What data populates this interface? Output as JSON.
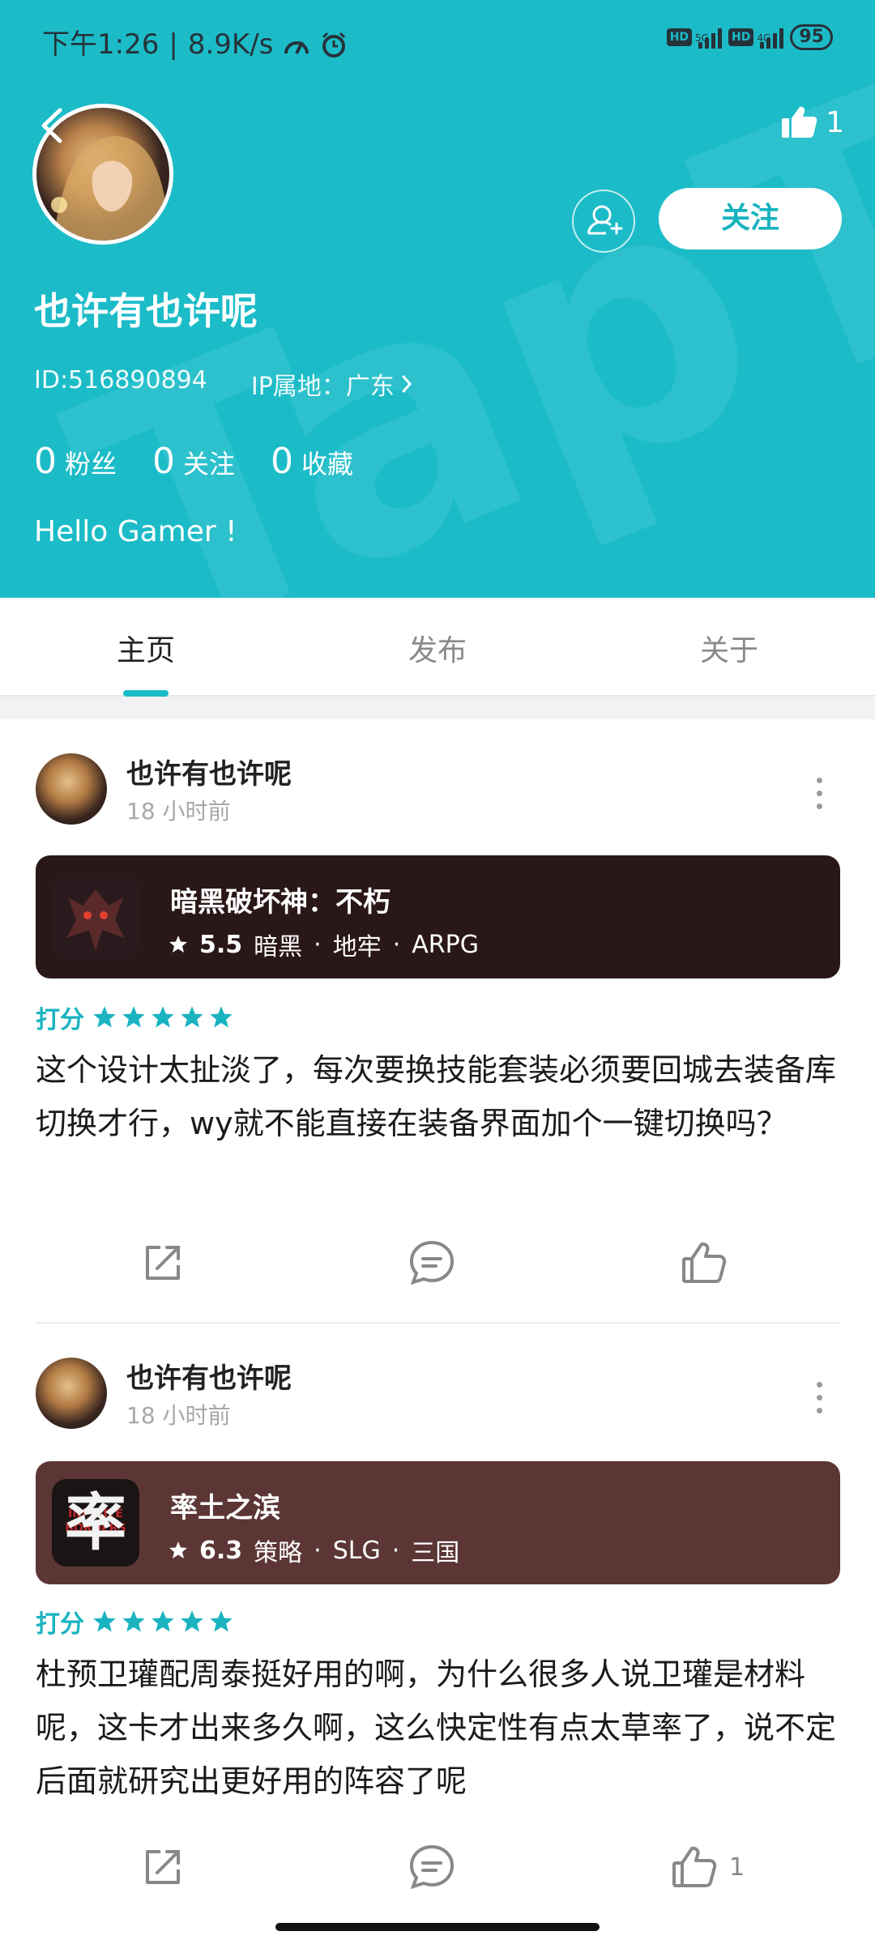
{
  "status_bar": {
    "time": "下午1:26",
    "speed": "8.9K/s",
    "network1": "5G",
    "network2": "4G",
    "hd": "HD",
    "battery": "95"
  },
  "profile": {
    "like_count": "1",
    "follow_label": "关注",
    "username": "也许有也许呢",
    "id_text": "ID:516890894",
    "ip_text": "IP属地：广东",
    "stats": [
      {
        "num": "0",
        "label": "粉丝"
      },
      {
        "num": "0",
        "label": "关注"
      },
      {
        "num": "0",
        "label": "收藏"
      }
    ],
    "bio": "Hello Gamer !",
    "watermark": "TapTap"
  },
  "tabs": [
    {
      "label": "主页",
      "active": true
    },
    {
      "label": "发布",
      "active": false
    },
    {
      "label": "关于",
      "active": false
    }
  ],
  "posts": [
    {
      "author": "也许有也许呢",
      "time": "18 小时前",
      "game": {
        "name": "暗黑破坏神：不朽",
        "score": "5.5",
        "tags": [
          "暗黑",
          "地牢",
          "ARPG"
        ],
        "card_color": "#2a1718",
        "icon_name": "diablo-demon-icon"
      },
      "rating_label": "打分",
      "rating_stars": 5,
      "content": "这个设计太扯淡了，每次要换技能套装必须要回城去装备库切换才行，wy就不能直接在装备界面加个一键切换吗？",
      "like_count": ""
    },
    {
      "author": "也许有也许呢",
      "time": "18 小时前",
      "game": {
        "name": "率土之滨",
        "score": "6.3",
        "tags": [
          "策略",
          "SLG",
          "三国"
        ],
        "card_color": "#5b3635",
        "icon_name": "shuai-character-icon",
        "icon_char": "率",
        "icon_overlay": "INFINITE BORDERS"
      },
      "rating_label": "打分",
      "rating_stars": 5,
      "content": "杜预卫瓘配周泰挺好用的啊，为什么很多人说卫瓘是材料呢，这卡才出来多久啊，这么快定性有点太草率了，说不定后面就研究出更好用的阵容了呢",
      "like_count": "1"
    }
  ],
  "colors": {
    "brand": "#1bbcc8",
    "rating": "#1bb3c0"
  }
}
